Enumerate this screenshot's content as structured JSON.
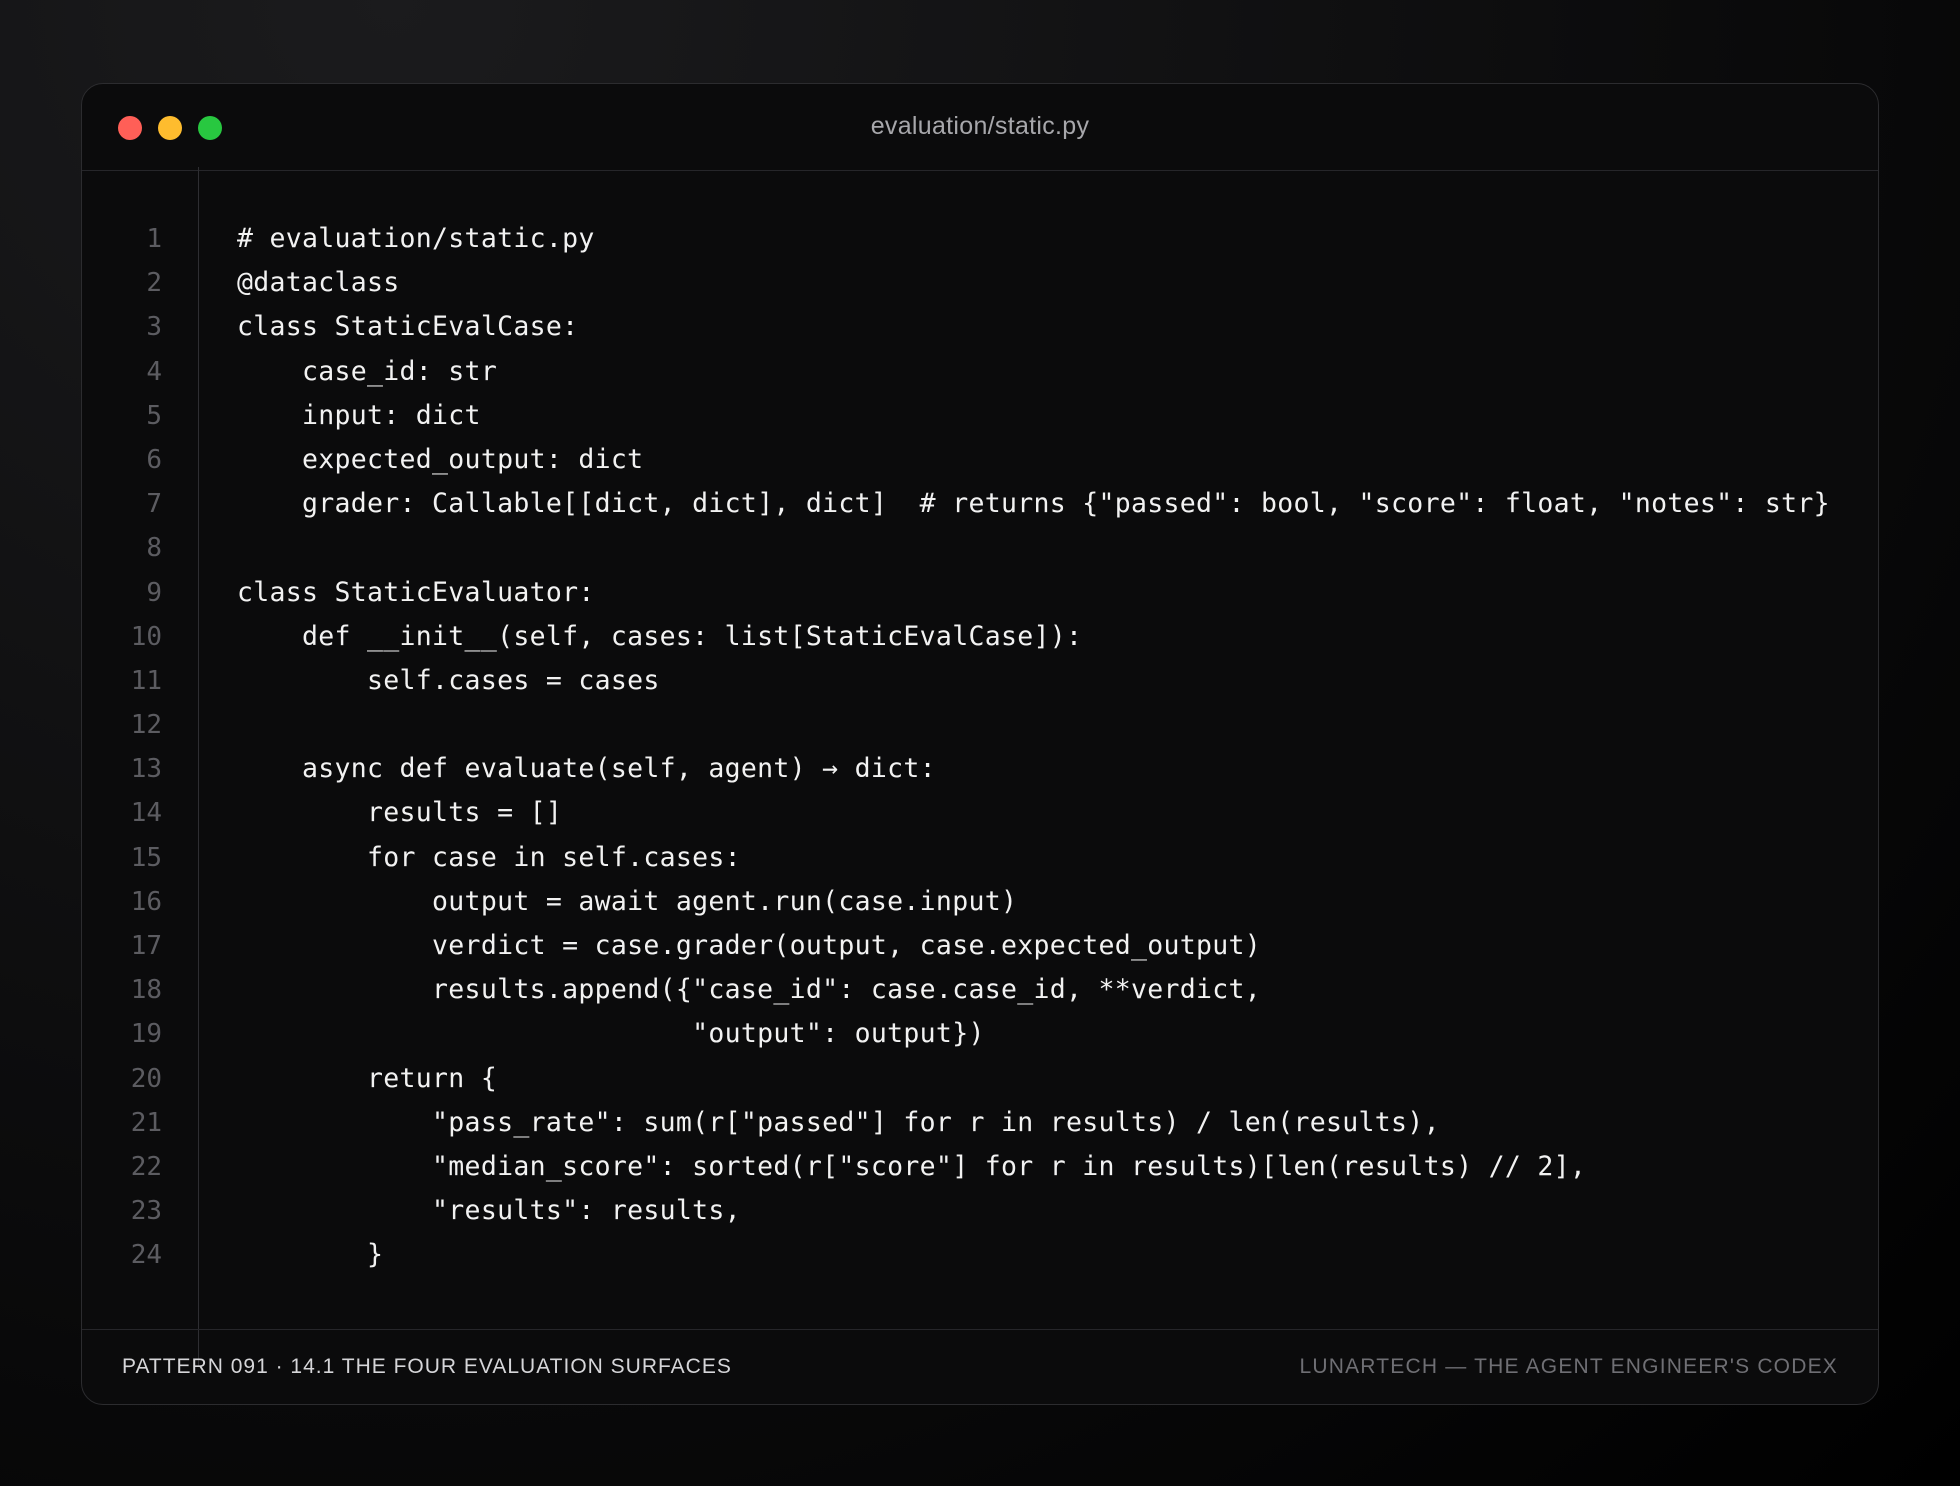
{
  "window": {
    "title": "evaluation/static.py",
    "controls": {
      "close_color": "#ff5f57",
      "minimize_color": "#febc2e",
      "maximize_color": "#28c840"
    }
  },
  "editor": {
    "gutter_color": "#2e2e32",
    "lines": [
      {
        "n": "1",
        "text": "# evaluation/static.py"
      },
      {
        "n": "2",
        "text": "@dataclass"
      },
      {
        "n": "3",
        "text": "class StaticEvalCase:"
      },
      {
        "n": "4",
        "text": "    case_id: str"
      },
      {
        "n": "5",
        "text": "    input: dict"
      },
      {
        "n": "6",
        "text": "    expected_output: dict"
      },
      {
        "n": "7",
        "text": "    grader: Callable[[dict, dict], dict]  # returns {\"passed\": bool, \"score\": float, \"notes\": str}"
      },
      {
        "n": "8",
        "text": ""
      },
      {
        "n": "9",
        "text": "class StaticEvaluator:"
      },
      {
        "n": "10",
        "text": "    def __init__(self, cases: list[StaticEvalCase]):"
      },
      {
        "n": "11",
        "text": "        self.cases = cases"
      },
      {
        "n": "12",
        "text": ""
      },
      {
        "n": "13",
        "text": "    async def evaluate(self, agent) → dict:"
      },
      {
        "n": "14",
        "text": "        results = []"
      },
      {
        "n": "15",
        "text": "        for case in self.cases:"
      },
      {
        "n": "16",
        "text": "            output = await agent.run(case.input)"
      },
      {
        "n": "17",
        "text": "            verdict = case.grader(output, case.expected_output)"
      },
      {
        "n": "18",
        "text": "            results.append({\"case_id\": case.case_id, **verdict,"
      },
      {
        "n": "19",
        "text": "                            \"output\": output})"
      },
      {
        "n": "20",
        "text": "        return {"
      },
      {
        "n": "21",
        "text": "            \"pass_rate\": sum(r[\"passed\"] for r in results) / len(results),"
      },
      {
        "n": "22",
        "text": "            \"median_score\": sorted(r[\"score\"] for r in results)[len(results) // 2],"
      },
      {
        "n": "23",
        "text": "            \"results\": results,"
      },
      {
        "n": "24",
        "text": "        }"
      }
    ]
  },
  "footer": {
    "left": "PATTERN 091 · 14.1 THE FOUR EVALUATION SURFACES",
    "right": "LUNARTECH — THE AGENT ENGINEER'S CODEX"
  }
}
